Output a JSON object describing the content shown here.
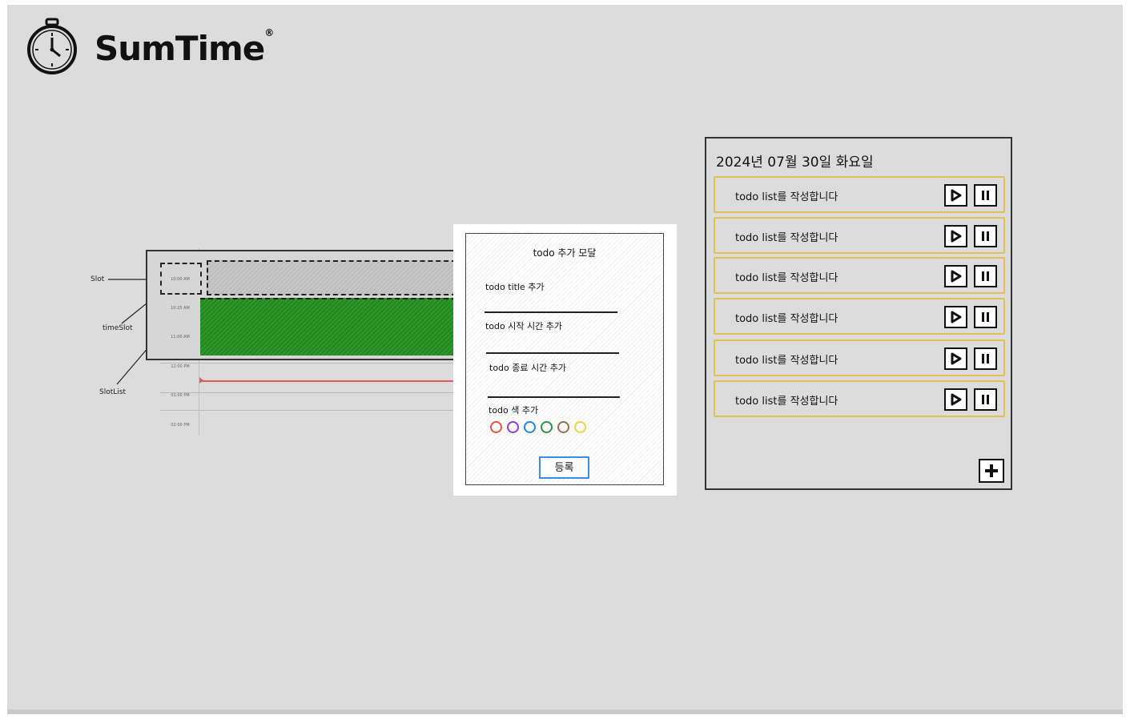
{
  "app": {
    "name": "SumTime",
    "trademark": "®"
  },
  "timeline": {
    "times": [
      "10:00 AM",
      "10:25 AM",
      "11:00 AM",
      "12:00 PM",
      "01:00 PM",
      "02:00 PM"
    ],
    "annotations": {
      "slot": "Slot",
      "time_slot": "timeSlot",
      "slot_list": "SlotList"
    },
    "colors": {
      "event": "#2f9a2a",
      "now_line": "#e05a5a"
    }
  },
  "modal": {
    "title": "todo 추가 모달",
    "title_label": "todo title 추가",
    "start_label": "todo 시작 시간 추가",
    "end_label": "todo 종료 시간 추가",
    "color_label": "todo 색 추가",
    "colors": [
      "#e2553a",
      "#8a3fd0",
      "#1e88d8",
      "#2e8f45",
      "#9a6b52",
      "#e8d44a"
    ],
    "submit_label": "등록"
  },
  "todo_panel": {
    "date": "2024년 07월 30일 화요일",
    "items": [
      {
        "text": "todo list를 작성합니다"
      },
      {
        "text": "todo list를 작성합니다"
      },
      {
        "text": "todo list를 작성합니다"
      },
      {
        "text": "todo list를 작성합니다"
      },
      {
        "text": "todo list를 작성합니다"
      },
      {
        "text": "todo list를 작성합니다"
      }
    ],
    "item_border_color": "#e0c050",
    "icons": {
      "play": "play-icon",
      "pause": "pause-icon",
      "add": "plus-icon"
    }
  }
}
